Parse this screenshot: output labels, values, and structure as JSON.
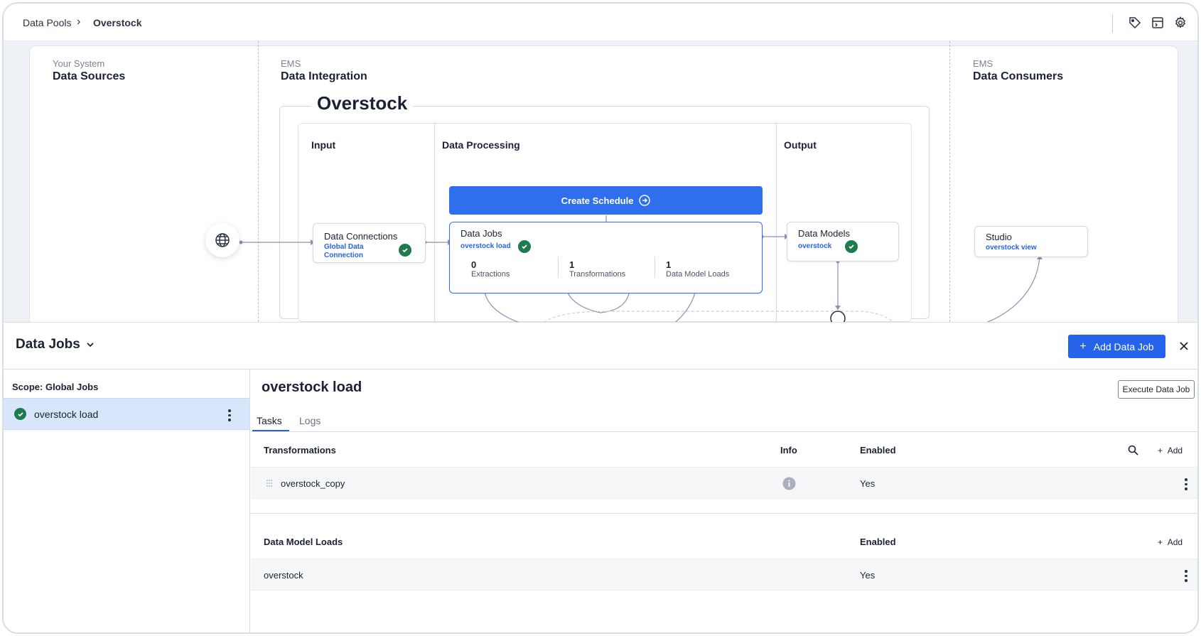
{
  "breadcrumb": {
    "parent": "Data Pools",
    "separator": "›",
    "current": "Overstock"
  },
  "toolbar_icons": [
    "tag-icon",
    "code-panel-icon",
    "gear-icon"
  ],
  "columns": {
    "sources": {
      "sub": "Your System",
      "title": "Data Sources"
    },
    "integration": {
      "sub": "EMS",
      "title": "Data Integration"
    },
    "consumers": {
      "sub": "EMS",
      "title": "Data Consumers"
    }
  },
  "pool": {
    "title": "Overstock",
    "sections": {
      "input": "Input",
      "processing": "Data Processing",
      "output": "Output"
    },
    "create_schedule": "Create Schedule",
    "connections": {
      "title": "Data Connections",
      "link": "Global Data Connection"
    },
    "jobs": {
      "title": "Data Jobs",
      "link": "overstock load",
      "stats": [
        {
          "value": "0",
          "label": "Extractions"
        },
        {
          "value": "1",
          "label": "Transformations"
        },
        {
          "value": "1",
          "label": "Data Model Loads"
        }
      ]
    },
    "models": {
      "title": "Data Models",
      "link": "overstock"
    },
    "studio": {
      "title": "Studio",
      "link": "overstock view"
    }
  },
  "panel": {
    "title": "Data Jobs",
    "add_button": "Add Data Job",
    "scope_label": "Scope: Global Jobs",
    "jobs": [
      {
        "name": "overstock load",
        "status": "success"
      }
    ],
    "selected_job": {
      "title": "overstock load",
      "execute_button": "Execute Data Job",
      "tabs": [
        "Tasks",
        "Logs"
      ],
      "active_tab": "Tasks",
      "transformations": {
        "header": "Transformations",
        "info_header": "Info",
        "enabled_header": "Enabled",
        "add_label": "Add",
        "rows": [
          {
            "name": "overstock_copy",
            "enabled": "Yes"
          }
        ]
      },
      "model_loads": {
        "header": "Data Model Loads",
        "enabled_header": "Enabled",
        "add_label": "Add",
        "rows": [
          {
            "name": "overstock",
            "enabled": "Yes"
          }
        ]
      }
    }
  },
  "colors": {
    "accent": "#2563eb",
    "success": "#1f7a4f",
    "canvas_bg": "#eef1f5",
    "selected_row": "#d7e6fb"
  }
}
